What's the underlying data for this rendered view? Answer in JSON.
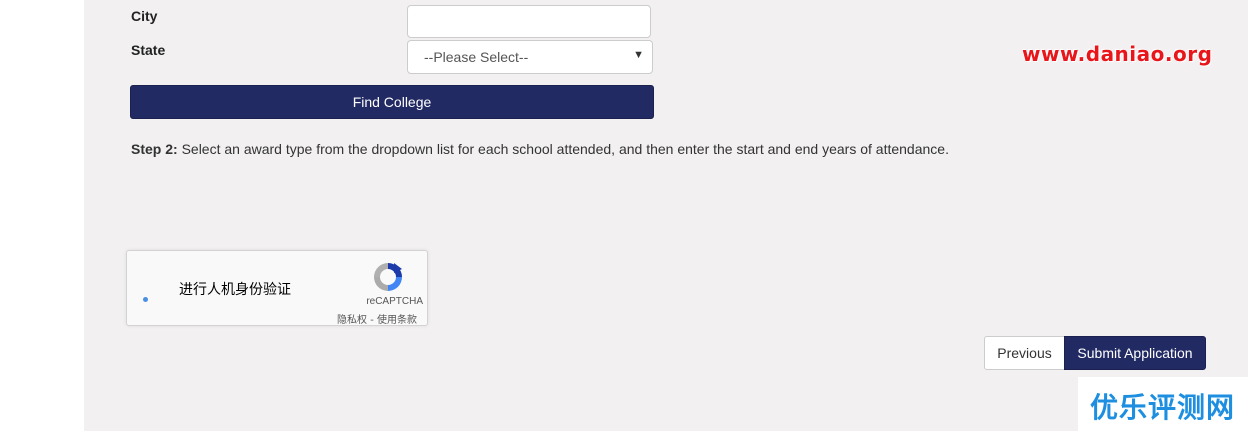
{
  "form": {
    "city_label": "City",
    "state_label": "State",
    "city_value": "",
    "state_selected": "--Please Select--",
    "find_button": "Find College"
  },
  "step2": {
    "prefix": "Step 2:",
    "text": " Select an award type from the dropdown list for each school attended, and then enter the start and end years of attendance."
  },
  "captcha": {
    "prompt": "进行人机身份验证",
    "brand": "reCAPTCHA",
    "terms": "隐私权 - 使用条款"
  },
  "nav": {
    "previous": "Previous",
    "submit": "Submit Application"
  },
  "watermarks": {
    "top": "www.daniao.org",
    "bottom": "优乐评测网"
  },
  "colors": {
    "primary_button": "#212a63",
    "page_background": "#f2f0f1",
    "watermark_red": "#e8161a",
    "watermark_blue": "#1e8fe0"
  }
}
